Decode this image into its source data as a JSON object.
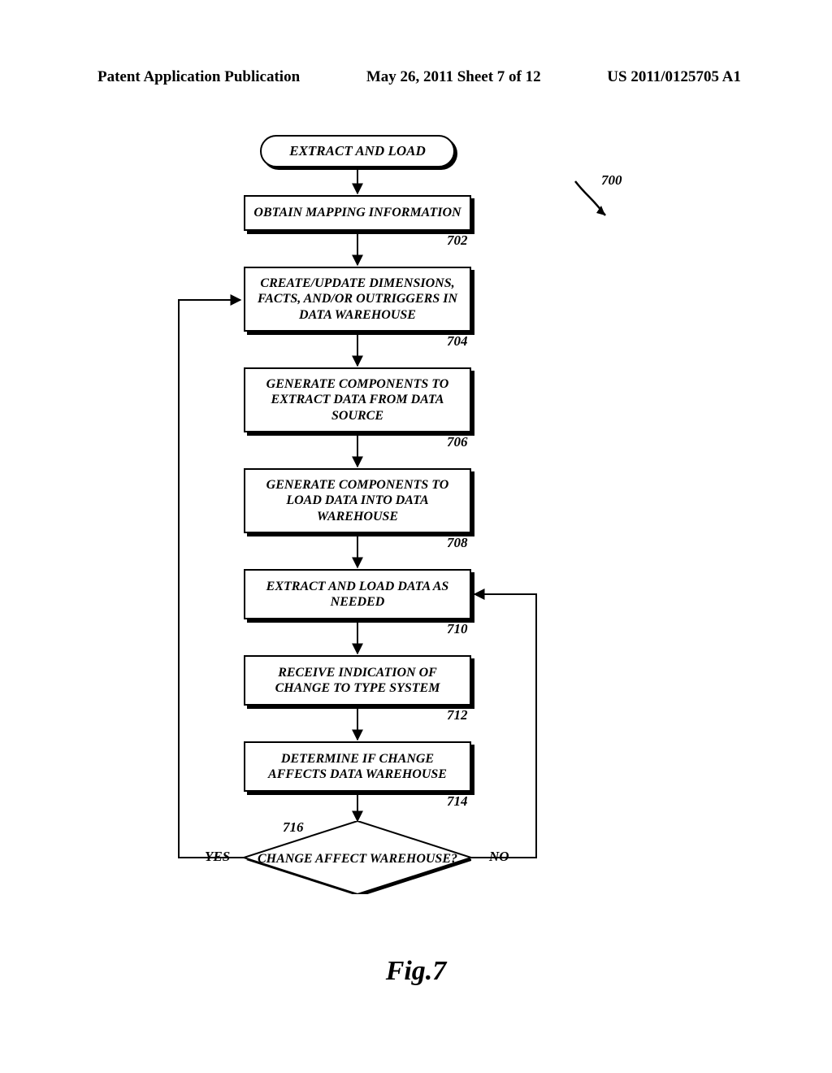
{
  "header": {
    "left": "Patent Application Publication",
    "center": "May 26, 2011  Sheet 7 of 12",
    "right": "US 2011/0125705 A1"
  },
  "figure": {
    "caption": "Fig.7",
    "overall_ref": "700"
  },
  "flow": {
    "terminator": {
      "label": "EXTRACT AND LOAD"
    },
    "step702": {
      "text": "OBTAIN MAPPING INFORMATION",
      "ref": "702"
    },
    "step704": {
      "text": "CREATE/UPDATE DIMENSIONS, FACTS, AND/OR OUTRIGGERS IN DATA WAREHOUSE",
      "ref": "704"
    },
    "step706": {
      "text": "GENERATE COMPONENTS TO EXTRACT DATA FROM DATA SOURCE",
      "ref": "706"
    },
    "step708": {
      "text": "GENERATE COMPONENTS TO LOAD DATA INTO DATA WAREHOUSE",
      "ref": "708"
    },
    "step710": {
      "text": "EXTRACT AND LOAD DATA AS NEEDED",
      "ref": "710"
    },
    "step712": {
      "text": "RECEIVE INDICATION OF CHANGE TO TYPE SYSTEM",
      "ref": "712"
    },
    "step714": {
      "text": "DETERMINE IF CHANGE AFFECTS DATA WAREHOUSE",
      "ref": "714"
    },
    "decision716": {
      "text": "CHANGE AFFECT WAREHOUSE?",
      "ref": "716",
      "yes": "YES",
      "no": "NO"
    }
  }
}
